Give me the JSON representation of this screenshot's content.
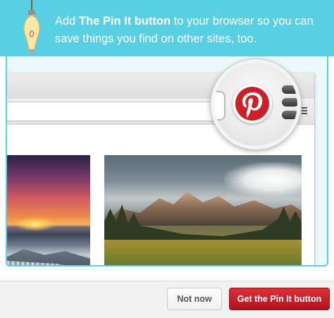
{
  "banner": {
    "text_before": "Add ",
    "text_bold": "The Pin It button",
    "text_after": " to your browser so you can save things you find on other sites, too.",
    "background_color": "#58cfe2"
  },
  "illustration": {
    "bulb_icon": "lightbulb-icon",
    "magnifier_icon": "pinterest-logo-icon",
    "menu_icon": "hamburger-menu-icon"
  },
  "footer": {
    "secondary_label": "Not now",
    "primary_label": "Get the Pin It button",
    "primary_color": "#c8232c"
  }
}
